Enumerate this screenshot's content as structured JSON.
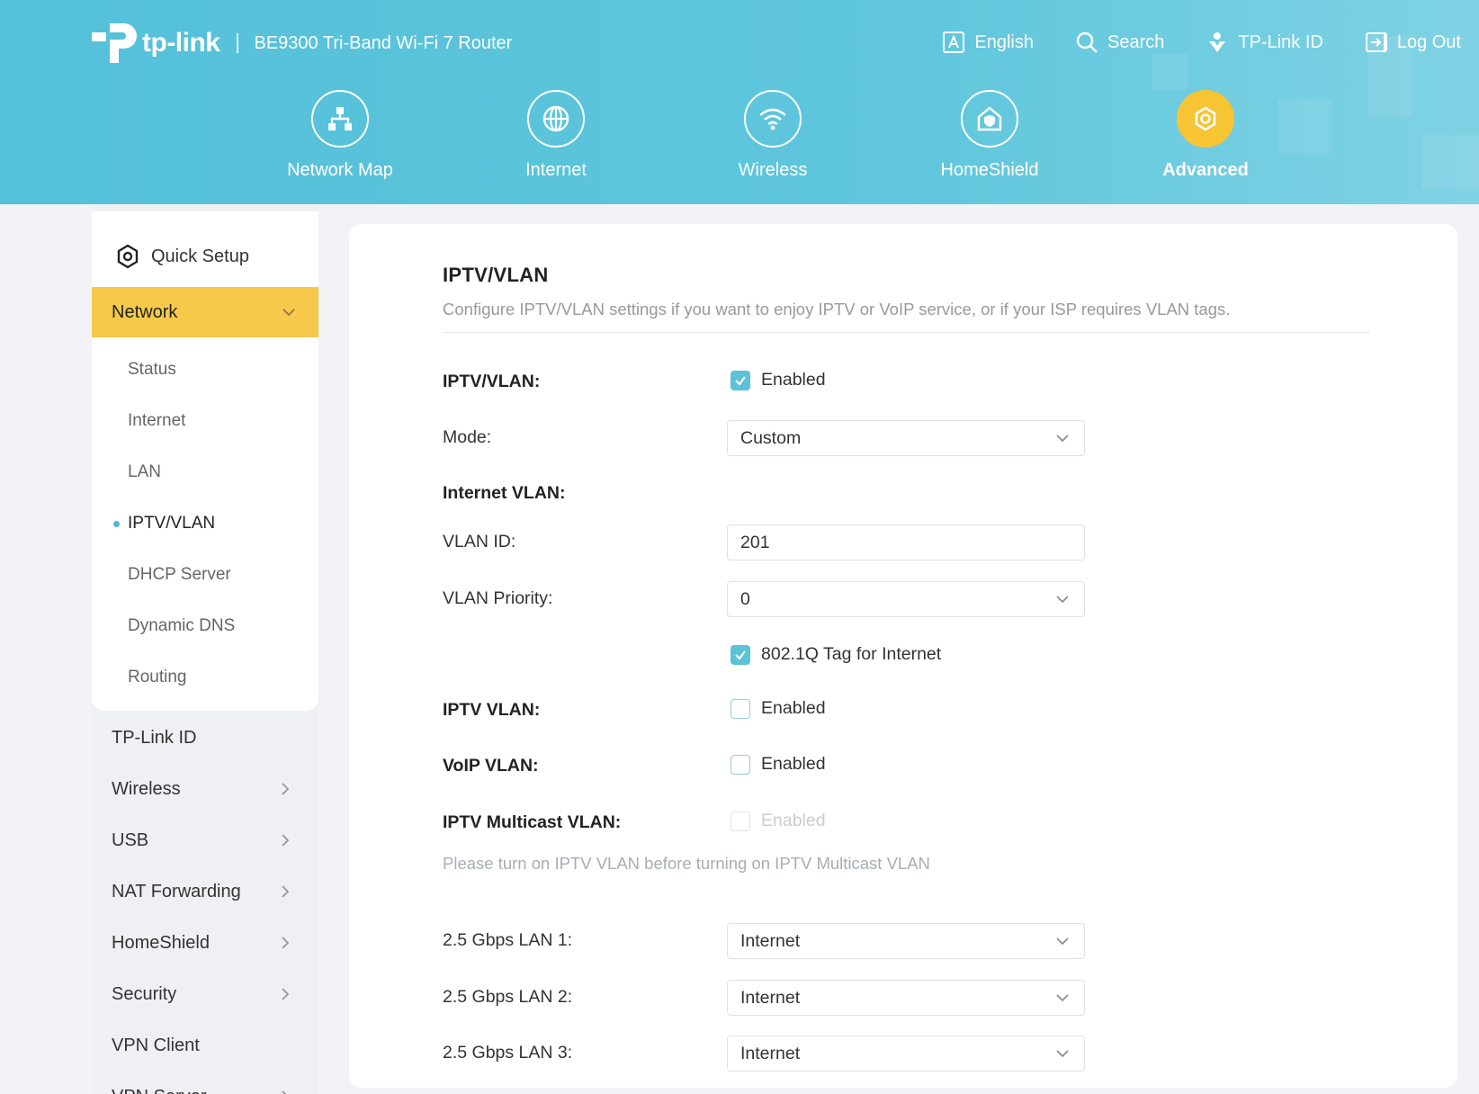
{
  "header": {
    "brand": "tp-link",
    "model": "BE9300 Tri-Band Wi-Fi 7 Router",
    "links": {
      "language": "English",
      "search": "Search",
      "tplink_id": "TP-Link ID",
      "logout": "Log Out"
    },
    "nav": {
      "network_map": "Network Map",
      "internet": "Internet",
      "wireless": "Wireless",
      "homeshield": "HomeShield",
      "advanced": "Advanced"
    },
    "active_color": "#f7c434"
  },
  "sidebar": {
    "quick_setup": "Quick Setup",
    "network": "Network",
    "network_sub": {
      "status": "Status",
      "internet": "Internet",
      "lan": "LAN",
      "iptv_vlan": "IPTV/VLAN",
      "dhcp_server": "DHCP Server",
      "dynamic_dns": "Dynamic DNS",
      "routing": "Routing"
    },
    "items": {
      "tplink_id": "TP-Link ID",
      "wireless": "Wireless",
      "usb": "USB",
      "nat_forwarding": "NAT Forwarding",
      "homeshield": "HomeShield",
      "security": "Security",
      "vpn_client": "VPN Client",
      "vpn_server": "VPN Server"
    }
  },
  "main": {
    "title": "IPTV/VLAN",
    "description": "Configure IPTV/VLAN settings if you want to enjoy IPTV or VoIP service, or if your ISP requires VLAN tags.",
    "iptv_vlan_label": "IPTV/VLAN:",
    "iptv_vlan_enabled": "Enabled",
    "mode_label": "Mode:",
    "mode_value": "Custom",
    "internet_vlan_label": "Internet VLAN:",
    "vlan_id_label": "VLAN ID:",
    "vlan_id_value": "201",
    "vlan_priority_label": "VLAN Priority:",
    "vlan_priority_value": "0",
    "tag_label": "802.1Q Tag for Internet",
    "iptv_vlan2_label": "IPTV VLAN:",
    "iptv_vlan2_enabled": "Enabled",
    "voip_label": "VoIP VLAN:",
    "voip_enabled": "Enabled",
    "multicast_label": "IPTV Multicast VLAN:",
    "multicast_enabled": "Enabled",
    "multicast_hint": "Please turn on IPTV VLAN before turning on IPTV Multicast VLAN",
    "lan1_label": "2.5 Gbps LAN 1:",
    "lan1_value": "Internet",
    "lan2_label": "2.5 Gbps LAN 2:",
    "lan2_value": "Internet",
    "lan3_label": "2.5 Gbps LAN 3:",
    "lan3_value": "Internet"
  }
}
